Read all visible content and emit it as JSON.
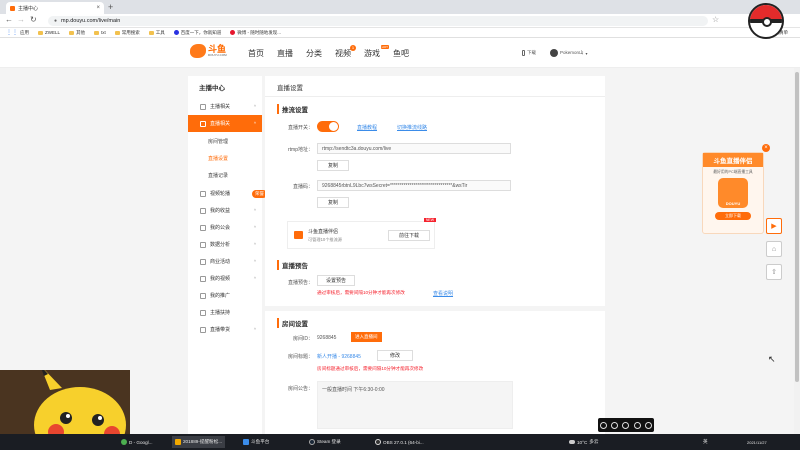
{
  "browser": {
    "tab_title": "主播中心",
    "new_tab": "+",
    "url": "mp.douyu.com/live/main",
    "bookmarks": [
      "应用",
      "ZWELL",
      "其他",
      "txt",
      "常用搜索",
      "工具",
      "百度一下，你就知道",
      "微博 - 随时随地发现..."
    ],
    "reading_list": "阅读清单"
  },
  "site": {
    "logo_text": "斗鱼",
    "logo_sub": "DOUYU.COM",
    "nav": [
      "首页",
      "直播",
      "分类",
      "视频",
      "游戏",
      "鱼吧"
    ],
    "nav_badge_video": "1",
    "nav_badge_game": "HOT",
    "download": "下载",
    "username": "Pokemon山"
  },
  "sidebar": {
    "title": "主播中心",
    "items": [
      {
        "label": "主播相关",
        "arrow": "^"
      },
      {
        "label": "直播相关",
        "arrow": "^"
      },
      {
        "label": "房间管理"
      },
      {
        "label": "直播设置"
      },
      {
        "label": "直播记录"
      },
      {
        "label": "视频轮播",
        "arrow": "^"
      },
      {
        "label": "我的收益",
        "arrow": "^"
      },
      {
        "label": "我的公会",
        "arrow": "^"
      },
      {
        "label": "数据分析",
        "arrow": "^"
      },
      {
        "label": "商业活动",
        "arrow": "^"
      },
      {
        "label": "我的视频",
        "arrow": "^"
      },
      {
        "label": "我的推广"
      },
      {
        "label": "主播扶持"
      },
      {
        "label": "直播带货",
        "arrow": "^"
      }
    ],
    "badge": "荣誉"
  },
  "content": {
    "page_title": "直播设置",
    "stream": {
      "section": "推流设置",
      "switch_label": "直播开关：",
      "link1": "直播教程",
      "link2": "切换推流线路",
      "rtmp_label": "rtmp地址：",
      "rtmp_value": "rtmp://sendtc3a.douyu.com/live",
      "copy1": "复制",
      "code_label": "直播码：",
      "code_value": "9268845rbtnL9Lbc7wsSecret=********************************&wsTir",
      "copy2": "复制",
      "helper_title": "斗鱼直播伴侣",
      "helper_sub": "可管理10个推流源",
      "helper_new": "NEW",
      "helper_btn": "前往下载"
    },
    "preview": {
      "section": "直播预告",
      "label": "直播预告：",
      "btn": "设置预告",
      "warn": "通过审核后，需要间隔10分钟才能再次修改",
      "link": "查看说明"
    },
    "room": {
      "section": "房间设置",
      "id_label": "房间ID：",
      "id_value": "9268845",
      "enter_btn": "进入直播间",
      "title_label": "房间标题：",
      "title_value": "新人开播 - 9268845",
      "edit_btn": "修改",
      "title_warn": "房间标题通过审核后，需要间隔10分钟才能再次修改",
      "notice_label": "房间公告：",
      "notice_value": "一般直播时间 下午6:30-0:00"
    }
  },
  "promo": {
    "title": "斗鱼直播伴侣",
    "desc": "最好用的PC端直播工具",
    "btn": "立即下载",
    "brand": "DOUYU"
  },
  "taskbar": {
    "items": [
      "D - Googl...",
      "201889-提醒粉松...",
      "斗鱼平台",
      "Steam 登录",
      "OBS 27.0.1 (64-bi..."
    ],
    "temp": "10°C",
    "weather": "多云",
    "lang": "英",
    "date": "2021/11/27"
  },
  "colors": {
    "accent": "#ff6c0a",
    "link": "#3b8ce9",
    "warn": "#f5222d"
  }
}
